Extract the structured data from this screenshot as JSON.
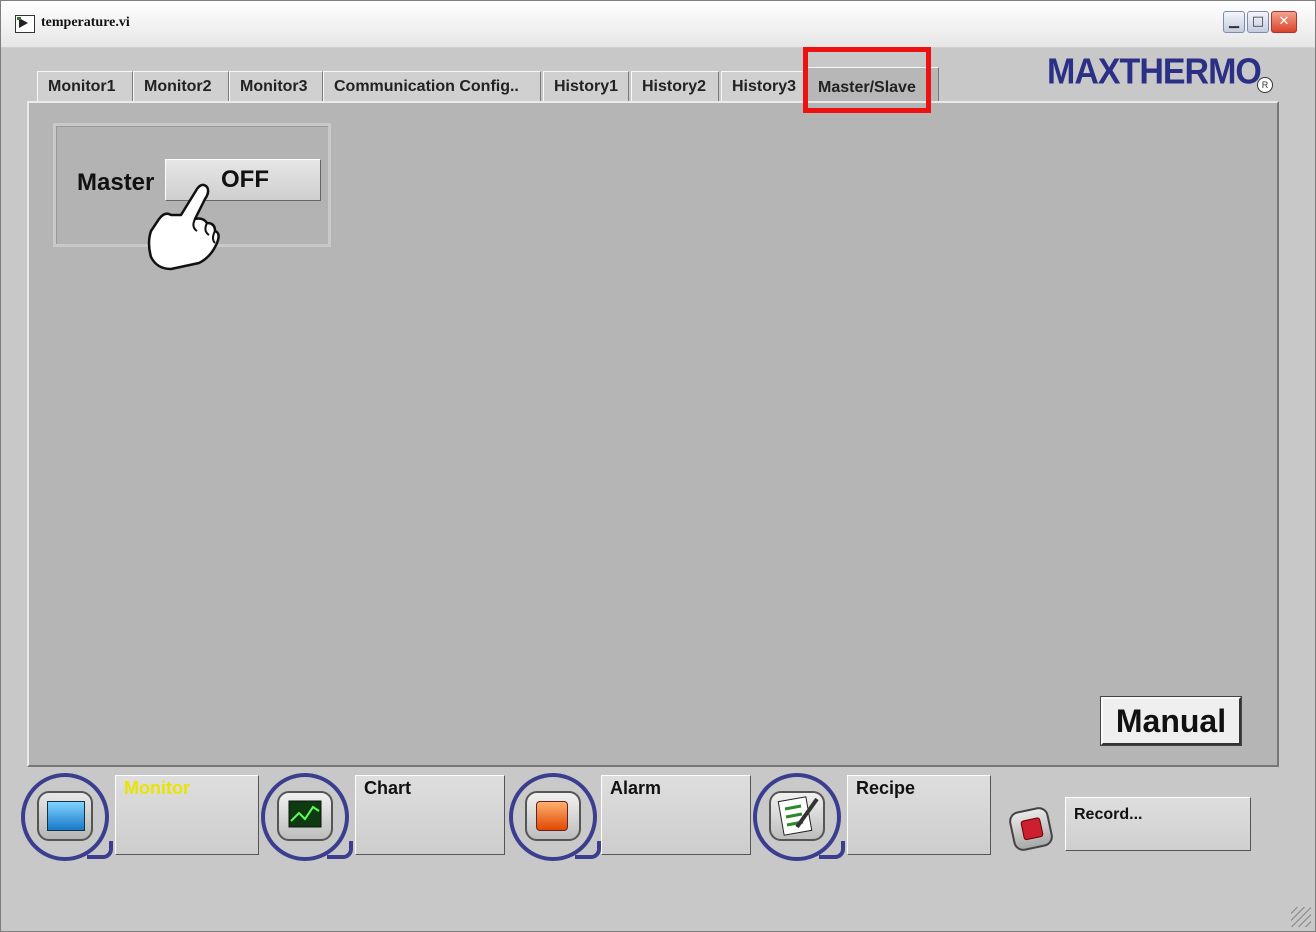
{
  "window": {
    "title": "temperature.vi",
    "minimize_symbol": "▁",
    "maximize_symbol": "□",
    "close_symbol": "✕"
  },
  "tabs": [
    {
      "label": "Monitor1",
      "active": false
    },
    {
      "label": "Monitor2",
      "active": false
    },
    {
      "label": "Monitor3",
      "active": false
    },
    {
      "label": "Communication Config..",
      "active": false
    },
    {
      "label": "History1",
      "active": false
    },
    {
      "label": "History2",
      "active": false
    },
    {
      "label": "History3",
      "active": false
    },
    {
      "label": "Master/Slave",
      "active": true
    }
  ],
  "brand": {
    "logo_text": "MAXTHERMO",
    "registered_mark": "R"
  },
  "master": {
    "label": "Master",
    "toggle_value": "OFF"
  },
  "manual_button": "Manual",
  "nav": {
    "monitor": {
      "label": "Monitor",
      "icon": "monitor-screen-icon"
    },
    "chart": {
      "label": "Chart",
      "icon": "chart-monitor-icon"
    },
    "alarm": {
      "label": "Alarm",
      "icon": "alarm-gauge-icon"
    },
    "recipe": {
      "label": "Recipe",
      "icon": "recipe-notepad-icon"
    },
    "record": {
      "label": "Record...",
      "icon": "record-stop-icon"
    }
  },
  "colors": {
    "highlight": "#ee1111",
    "brand": "#2c2f86",
    "monitor_label": "#e8e400"
  }
}
